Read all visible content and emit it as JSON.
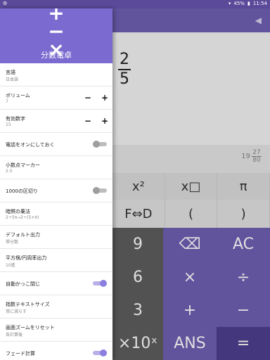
{
  "status": {
    "left_icon": "android-debug-icon",
    "battery": "45%",
    "time": "11:54"
  },
  "calc": {
    "display": {
      "numerator": "2",
      "denominator": "5"
    },
    "subresult": {
      "whole": "19",
      "numerator": "27",
      "denominator": "80"
    },
    "row1": [
      "x²",
      "x□",
      "π"
    ],
    "row2": [
      "F⇔D",
      "(",
      ")"
    ],
    "keypad": [
      {
        "label": "9",
        "type": "num"
      },
      {
        "label": "⌫",
        "type": "op"
      },
      {
        "label": "AC",
        "type": "op"
      },
      {
        "label": "6",
        "type": "num"
      },
      {
        "label": "×",
        "type": "op"
      },
      {
        "label": "÷",
        "type": "op"
      },
      {
        "label": "3",
        "type": "num"
      },
      {
        "label": "+",
        "type": "op"
      },
      {
        "label": "−",
        "type": "op"
      },
      {
        "label": "×10ˣ",
        "type": "num"
      },
      {
        "label": "ANS",
        "type": "op"
      },
      {
        "label": "=",
        "type": "eq"
      }
    ]
  },
  "drawer": {
    "logo": "+ −\n× ÷",
    "title": "分数電卓",
    "items": [
      {
        "label": "言語",
        "value": "日本語",
        "control": "none"
      },
      {
        "label": "ボリューム",
        "value": "7",
        "control": "stepper"
      },
      {
        "label": "有効数字",
        "value": "15",
        "control": "stepper"
      },
      {
        "label": "電話をオンにしておく",
        "value": "",
        "control": "toggle",
        "on": false
      },
      {
        "label": "小数点マーカー",
        "value": "2.5",
        "control": "none"
      },
      {
        "label": "1000の区切り",
        "value": "",
        "control": "toggle",
        "on": false
      },
      {
        "label": "暗黙の乗法",
        "value": "2÷5π→2÷(5×π)",
        "control": "none"
      },
      {
        "label": "デフォルト出力",
        "value": "帯分数",
        "control": "none"
      },
      {
        "label": "平方根/円周率出力",
        "value": "10進",
        "control": "none"
      },
      {
        "label": "自動かっこ閉じ",
        "value": "",
        "control": "toggle",
        "on": true
      },
      {
        "label": "指数テキストサイズ",
        "value": "常に減らす",
        "control": "none"
      },
      {
        "label": "画面ズームをリセット",
        "value": "各計算後",
        "control": "none"
      },
      {
        "label": "フェード計算",
        "value": "",
        "control": "toggle",
        "on": true
      }
    ]
  }
}
